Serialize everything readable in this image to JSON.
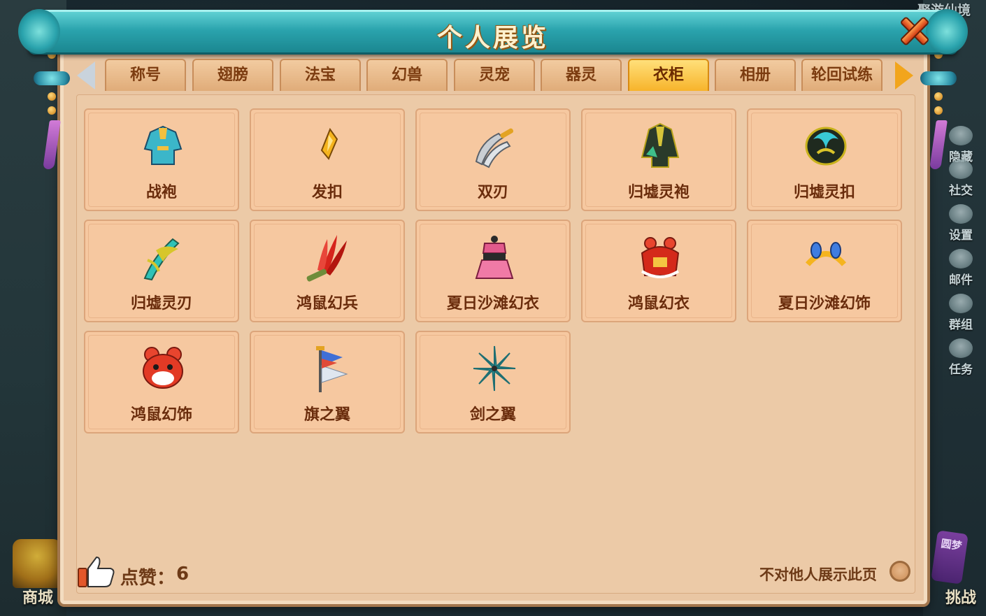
{
  "window": {
    "title": "个人展览"
  },
  "tabs": [
    {
      "label": "称号",
      "active": false
    },
    {
      "label": "翅膀",
      "active": false
    },
    {
      "label": "法宝",
      "active": false
    },
    {
      "label": "幻兽",
      "active": false
    },
    {
      "label": "灵宠",
      "active": false
    },
    {
      "label": "器灵",
      "active": false
    },
    {
      "label": "衣柜",
      "active": true
    },
    {
      "label": "相册",
      "active": false
    },
    {
      "label": "轮回试练",
      "active": false
    }
  ],
  "items": [
    {
      "label": "战袍",
      "icon": "robe-icon"
    },
    {
      "label": "发扣",
      "icon": "hair-clasp-icon"
    },
    {
      "label": "双刃",
      "icon": "twin-blade-icon"
    },
    {
      "label": "归墟灵袍",
      "icon": "guixu-robe-icon"
    },
    {
      "label": "归墟灵扣",
      "icon": "guixu-clasp-icon"
    },
    {
      "label": "归墟灵刃",
      "icon": "guixu-blade-icon"
    },
    {
      "label": "鸿鼠幻兵",
      "icon": "rat-weapon-icon"
    },
    {
      "label": "夏日沙滩幻衣",
      "icon": "beach-outfit-icon"
    },
    {
      "label": "鸿鼠幻衣",
      "icon": "rat-outfit-icon"
    },
    {
      "label": "夏日沙滩幻饰",
      "icon": "beach-accessory-icon"
    },
    {
      "label": "鸿鼠幻饰",
      "icon": "rat-accessory-icon"
    },
    {
      "label": "旗之翼",
      "icon": "flag-wing-icon"
    },
    {
      "label": "剑之翼",
      "icon": "sword-wing-icon"
    }
  ],
  "footer": {
    "like_label": "点赞：",
    "like_count": "6",
    "hide_label": "不对他人展示此页"
  },
  "background": {
    "top_right": "聚游仙境",
    "side_buttons": [
      "隐藏",
      "社交",
      "设置",
      "邮件",
      "群组",
      "任务"
    ],
    "shop": "商城",
    "challenge": "挑战",
    "dream": "圆梦"
  },
  "colors": {
    "panel_bg": "#e9c6a3",
    "card_bg": "#f6c8a0",
    "title_teal": "#2aa3ad",
    "active_tab": "#f7b42b",
    "text_brown": "#6a2c0c"
  }
}
